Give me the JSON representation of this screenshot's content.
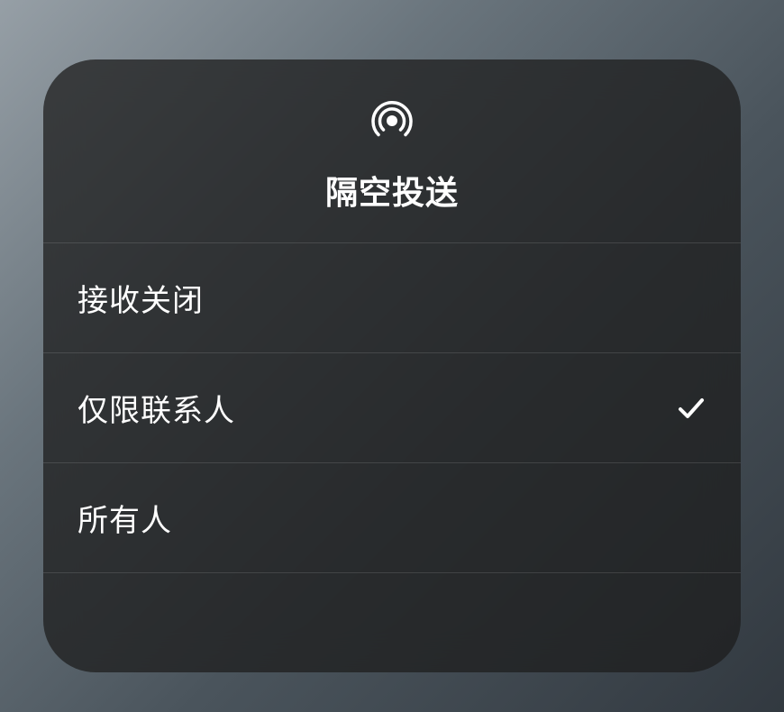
{
  "panel": {
    "title": "隔空投送",
    "options": {
      "off": {
        "label": "接收关闭",
        "selected": false
      },
      "contacts": {
        "label": "仅限联系人",
        "selected": true
      },
      "everyone": {
        "label": "所有人",
        "selected": false
      }
    }
  }
}
